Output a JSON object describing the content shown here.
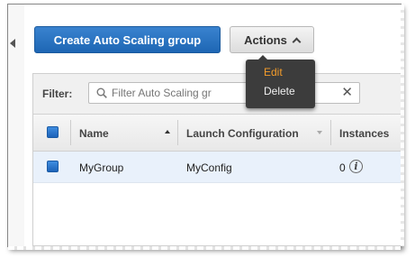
{
  "toolbar": {
    "create_label": "Create Auto Scaling group",
    "actions_label": "Actions"
  },
  "actions_menu": {
    "items": [
      {
        "label": "Edit",
        "state": "hover"
      },
      {
        "label": "Delete"
      }
    ]
  },
  "filter": {
    "label": "Filter:",
    "placeholder": "Filter Auto Scaling gr",
    "clear_icon": "close-icon"
  },
  "table": {
    "columns": [
      "Name",
      "Launch Configuration",
      "Instances"
    ],
    "rows": [
      {
        "name": "MyGroup",
        "launch_configuration": "MyConfig",
        "instances": "0",
        "selected": true
      }
    ]
  },
  "colors": {
    "primary": "#1e66b4",
    "menu_bg": "#3c3c3c",
    "menu_active": "#f39c2b",
    "selected_row": "#e9f1fb"
  }
}
